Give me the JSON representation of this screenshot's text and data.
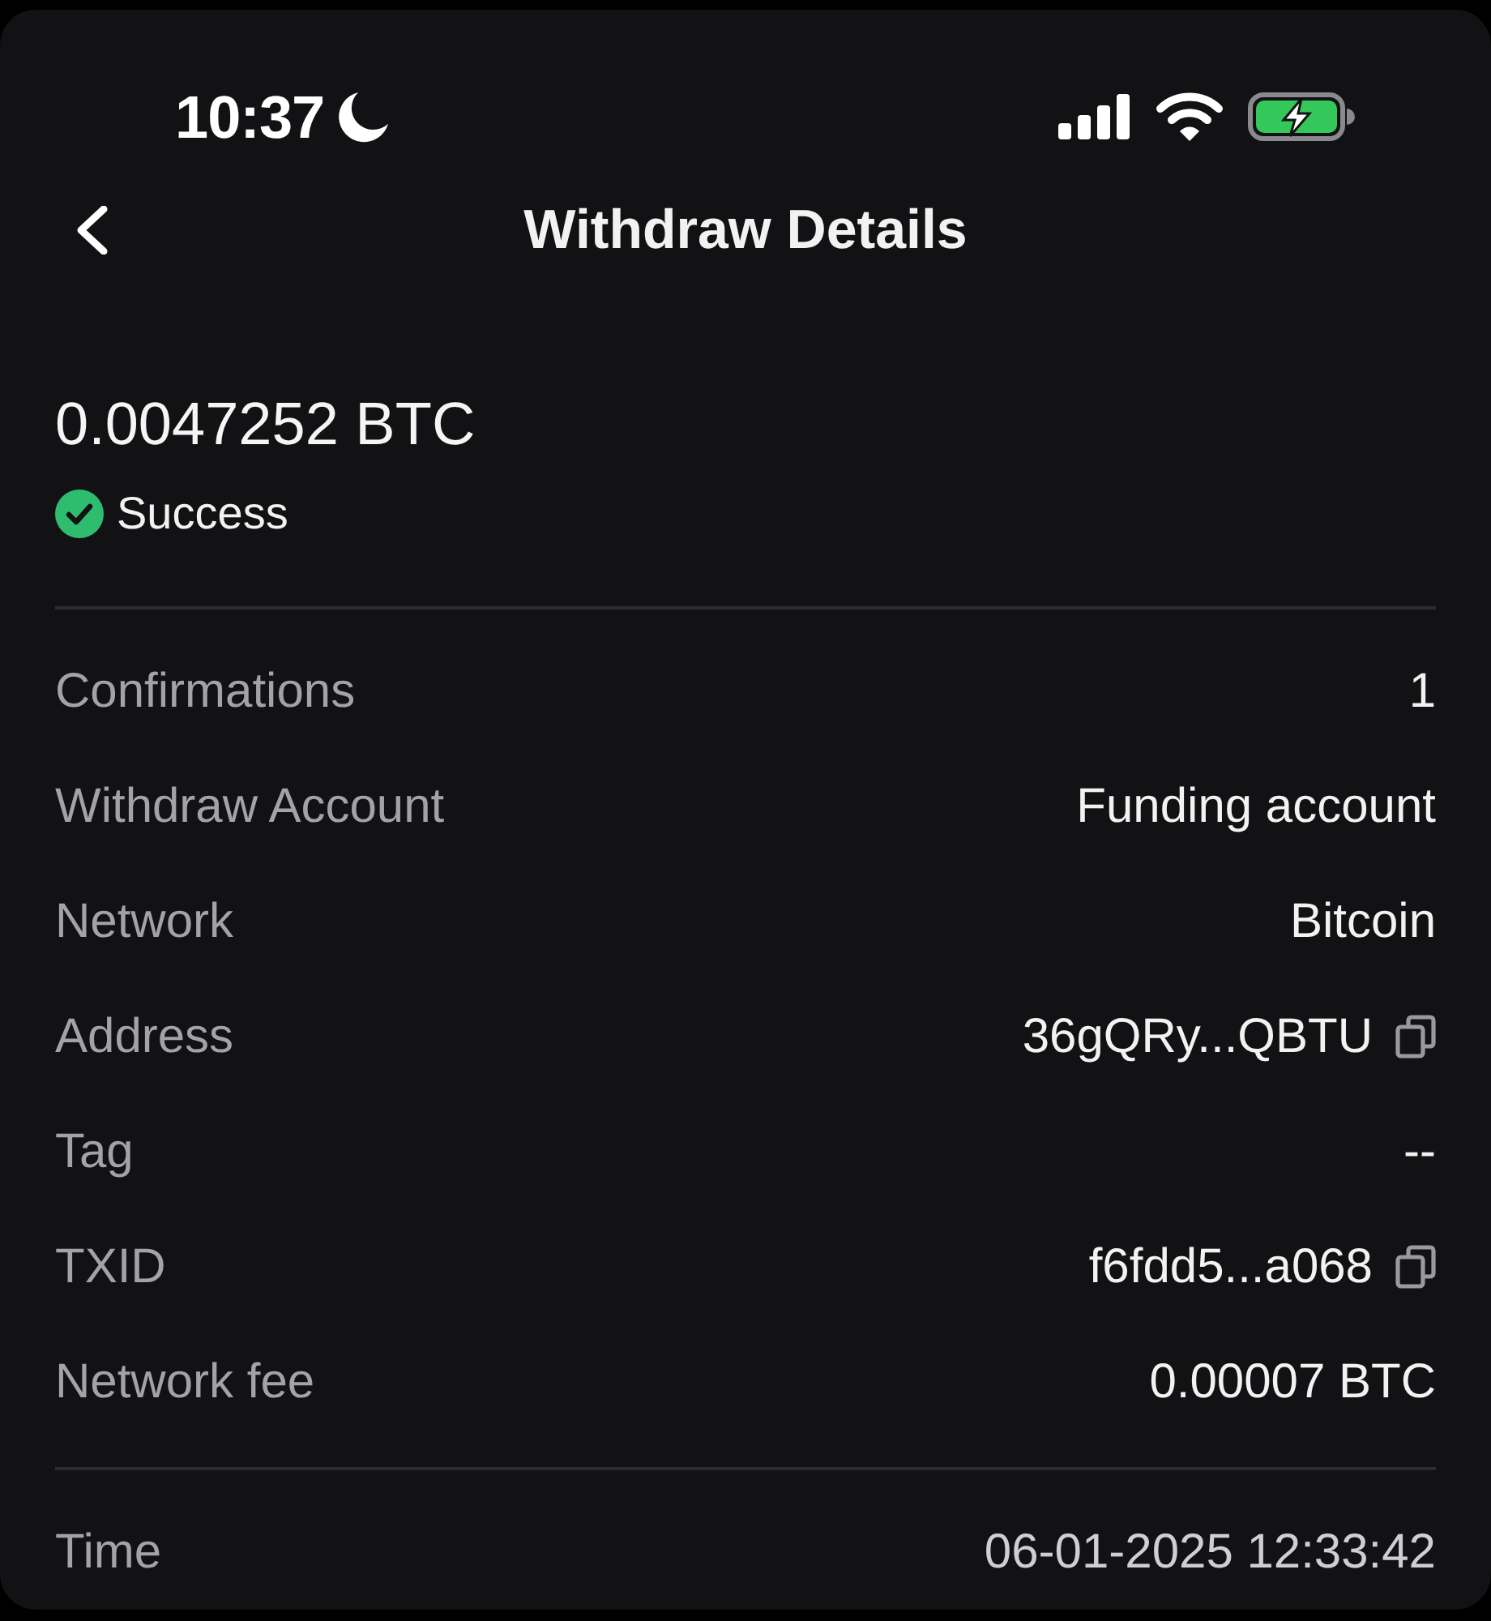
{
  "status_bar": {
    "time": "10:37"
  },
  "header": {
    "title": "Withdraw Details"
  },
  "summary": {
    "amount": "0.0047252 BTC",
    "status": "Success"
  },
  "details": [
    {
      "label": "Confirmations",
      "value": "1",
      "copyable": false
    },
    {
      "label": "Withdraw Account",
      "value": "Funding account",
      "copyable": false
    },
    {
      "label": "Network",
      "value": "Bitcoin",
      "copyable": false
    },
    {
      "label": "Address",
      "value": "36gQRy...QBTU",
      "copyable": true
    },
    {
      "label": "Tag",
      "value": "--",
      "copyable": false
    },
    {
      "label": "TXID",
      "value": "f6fdd5...a068",
      "copyable": true
    },
    {
      "label": "Network fee",
      "value": "0.00007 BTC",
      "copyable": false
    }
  ],
  "footer_rows": [
    {
      "label": "Time",
      "value": "06-01-2025 12:33:42"
    }
  ]
}
